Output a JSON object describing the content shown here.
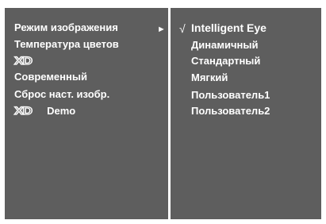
{
  "left_menu": {
    "items": [
      {
        "label": "Режим изображения"
      },
      {
        "label": "Температура цветов"
      },
      {
        "logo_text": "XD"
      },
      {
        "label": "Современный"
      },
      {
        "label": "Сброс наст. изобр."
      },
      {
        "logo_text": "XD",
        "label": "Demo"
      }
    ],
    "arrow_glyph": "►"
  },
  "right_menu": {
    "check_glyph": "√",
    "items": [
      {
        "label": "Intelligent Eye",
        "selected": true
      },
      {
        "label": "Динамичный"
      },
      {
        "label": "Стандартный"
      },
      {
        "label": "Мягкий"
      },
      {
        "label": "Пользователь1"
      },
      {
        "label": "Пользователь2"
      }
    ]
  },
  "colors": {
    "panel": "#5e5e5e",
    "text": "#ffffff",
    "background": "#ffffff"
  }
}
